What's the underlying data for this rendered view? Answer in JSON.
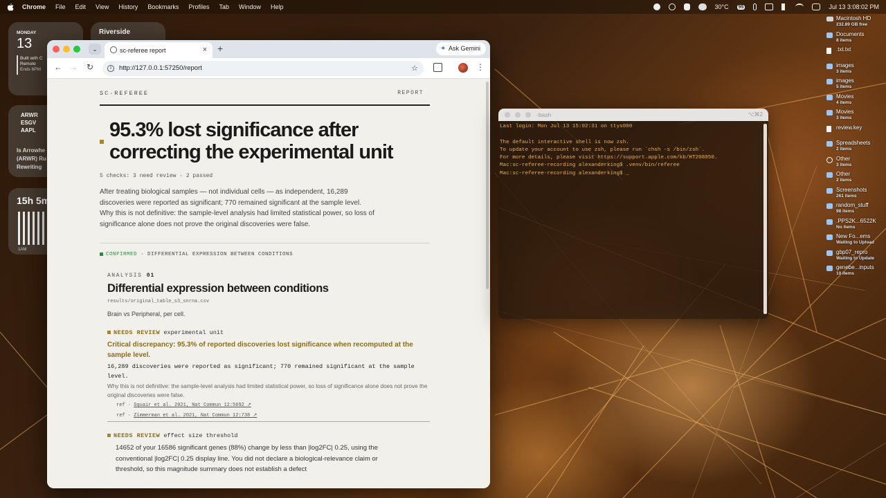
{
  "menubar": {
    "app": "Chrome",
    "items": [
      "File",
      "Edit",
      "View",
      "History",
      "Bookmarks",
      "Profiles",
      "Tab",
      "Window",
      "Help"
    ],
    "temperature": "30°C",
    "battery": "95",
    "datetime": "Jul 13  3:08:02 PM"
  },
  "widgets": {
    "calendar": {
      "day_name": "MONDAY",
      "day_num": "13",
      "event_lines": [
        "Built with C",
        "Remote",
        "Ends 6PM"
      ]
    },
    "weather": {
      "city": "Riverside"
    },
    "stocks": {
      "tickers": [
        "ARWR",
        "ESGV",
        "AAPL"
      ],
      "news": "Is Arrowhe (ARWR) Ru Rewriting"
    },
    "screentime": {
      "total": "15h 5m",
      "axis_label": "1AM"
    }
  },
  "desktop_icons": [
    {
      "name": "Macintosh HD",
      "sub": "232.89 GB free",
      "icon": "drive-icon"
    },
    {
      "name": "Documents",
      "sub": "8 items",
      "icon": "folder-icon"
    },
    {
      "name": ".txt.txt",
      "sub": "",
      "icon": "document-icon"
    },
    {
      "name": "images",
      "sub": "3 items",
      "icon": "folder-icon"
    },
    {
      "name": "images",
      "sub": "5 items",
      "icon": "folder-icon"
    },
    {
      "name": "Movies",
      "sub": "4 items",
      "icon": "folder-icon"
    },
    {
      "name": "Movies",
      "sub": "3 items",
      "icon": "folder-icon"
    },
    {
      "name": "review.key",
      "sub": "",
      "icon": "document-icon"
    },
    {
      "name": "Spreadsheets",
      "sub": "2 items",
      "icon": "folder-icon"
    },
    {
      "name": "Other",
      "sub": "3 items",
      "icon": "circle-icon"
    },
    {
      "name": "Other",
      "sub": "2 items",
      "icon": "folder-icon"
    },
    {
      "name": "Screenshots",
      "sub": "261 items",
      "icon": "folder-icon"
    },
    {
      "name": "random_stuff",
      "sub": "98 items",
      "icon": "folder-icon"
    },
    {
      "name": ".PPS2K...6522K",
      "sub": "No items",
      "icon": "folder-icon"
    },
    {
      "name": "New Fo...ems",
      "sub": "Waiting to Upload",
      "icon": "folder-icon"
    },
    {
      "name": "gbp07_repro",
      "sub": "Waiting to Update",
      "icon": "folder-icon"
    },
    {
      "name": "genebe...inputs",
      "sub": "10 items",
      "icon": "folder-icon"
    }
  ],
  "browser": {
    "tab_title": "sc-referee report",
    "ask_gemini": "Ask Gemini",
    "url": "http://127.0.0.1:57250/report"
  },
  "page": {
    "brand": "SC·REFEREE",
    "nav_report": "REPORT",
    "headline": "95.3% lost significance after correcting the experimental unit",
    "meta": "5 checks: 3 need review · 2 passed",
    "lead": "After treating biological samples — not individual cells — as independent, 16,289 discoveries were reported as significant; 770 remained significant at the sample level. Why this is not definitive: the sample-level analysis had limited statistical power, so loss of significance alone does not prove the original discoveries were false.",
    "confirmed_label": "CONFIRMED",
    "confirmed_text": "· DIFFERENTIAL EXPRESSION BETWEEN CONDITIONS",
    "analysis": {
      "label": "ANALYSIS",
      "number": "01",
      "title": "Differential expression between conditions",
      "file": "results/original_table_s3_snrna.csv",
      "desc": "Brain vs Peripheral, per cell."
    },
    "finding1": {
      "status": "NEEDS REVIEW",
      "name": "experimental unit",
      "headline": "Critical discrepancy: 95.3% of reported discoveries lost significance when recomputed at the sample level.",
      "evidence": "16,289 discoveries were reported as significant; 770 remained significant at the sample level.",
      "caveat": "Why this is not definitive: the sample-level analysis had limited statistical power, so loss of significance alone does not prove the original discoveries were false.",
      "refs": [
        {
          "prefix": "ref ·",
          "text": "Squair et al. 2021, Nat Commun 12:5692 ↗"
        },
        {
          "prefix": "ref ·",
          "text": "Zimmerman et al. 2021, Nat Commun 12:738 ↗"
        }
      ]
    },
    "finding2": {
      "status": "NEEDS REVIEW",
      "name": "effect size threshold",
      "body": "14652 of your 16586 significant genes (88%) change by less than |log2FC| 0.25, using the conventional |log2FC| 0.25 display line. You did not declare a biological-relevance claim or threshold, so this magnitude summary does not establish a defect"
    }
  },
  "terminal": {
    "title": "-bash",
    "shortcut": "⌥⌘2",
    "lines": [
      "Last login: Mon Jul 13 15:02:31 on ttys000",
      "",
      "The default interactive shell is now zsh.",
      "To update your account to use zsh, please run `chsh -s /bin/zsh`.",
      "For more details, please visit https://support.apple.com/kb/HT208050.",
      "Mac:sc-referee-recording alexanderking$ .venv/bin/referee",
      "Mac:sc-referee-recording alexanderking$ _"
    ]
  },
  "colors": {
    "accent_gold": "#a8842a",
    "confirmed_green": "#2d8a3e",
    "terminal_text": "#e8b24a",
    "page_bg": "#f1f0ea"
  }
}
